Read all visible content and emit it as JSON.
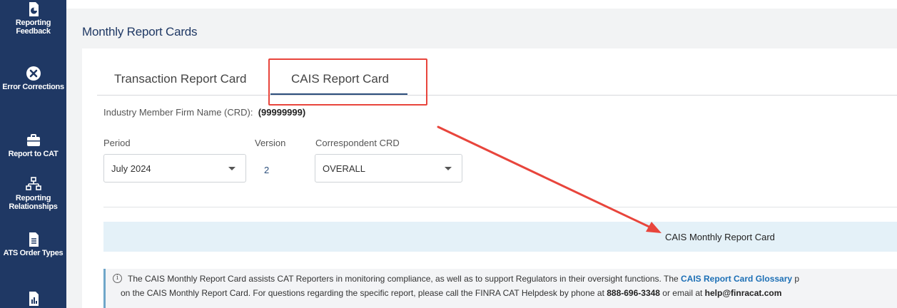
{
  "sidebar": {
    "items": [
      {
        "label": "Reporting Feedback",
        "icon": "pie-chart-doc-icon"
      },
      {
        "label": "Error Corrections",
        "icon": "close-circle-icon"
      },
      {
        "label": "Report to CAT",
        "icon": "briefcase-icon"
      },
      {
        "label": "Reporting Relationships",
        "icon": "sitemap-icon"
      },
      {
        "label": "ATS Order Types",
        "icon": "document-icon"
      },
      {
        "label": "",
        "icon": "bar-chart-doc-icon"
      }
    ]
  },
  "header": {
    "title": "Monthly Report Cards"
  },
  "tabs": [
    {
      "label": "Transaction Report Card"
    },
    {
      "label": "CAIS Report Card",
      "active": true
    }
  ],
  "firm": {
    "label": "Industry Member Firm Name (CRD):",
    "value": "(99999999)"
  },
  "filters": {
    "period": {
      "label": "Period",
      "value": "July 2024"
    },
    "version": {
      "label": "Version",
      "value": "2"
    },
    "correspondent": {
      "label": "Correspondent CRD",
      "value": "OVERALL"
    }
  },
  "banner": {
    "title": "CAIS Monthly Report Card"
  },
  "info": {
    "line1_prefix": "The CAIS Monthly Report Card assists CAT Reporters in monitoring compliance, as well as to support Regulators in their oversight functions. The ",
    "glossary_link": "CAIS Report Card Glossary",
    "line1_suffix": " p",
    "line2_prefix": "on the CAIS Monthly Report Card. For questions regarding the specific report, please call the FINRA CAT Helpdesk by phone at ",
    "phone": "888-696-3348",
    "line2_mid": " or email at ",
    "email": "help@finracat.com"
  },
  "colors": {
    "sidebar": "#1f3864",
    "accent": "#2d4f7c",
    "annotation": "#e8453c",
    "banner": "#e4f1f8"
  }
}
